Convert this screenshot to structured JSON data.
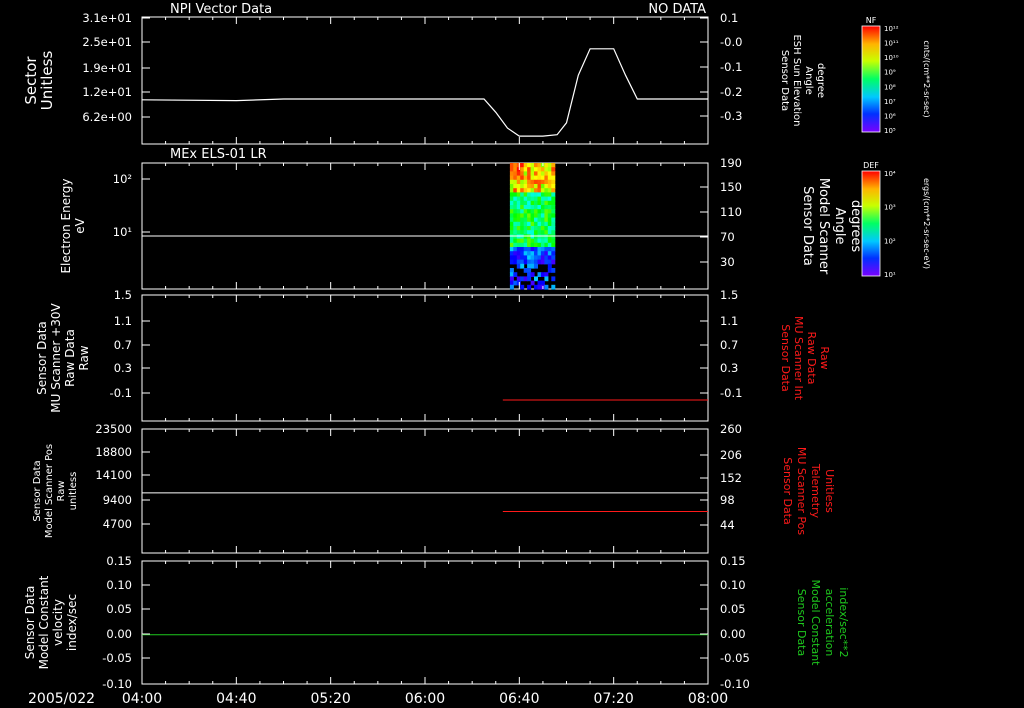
{
  "header": {
    "panel1_title": "NPI Vector Data",
    "panel1_status": "NO DATA",
    "panel2_title": "MEx ELS-01 LR"
  },
  "time_axis": {
    "date": "2005/022",
    "start": "04:00",
    "end": "08:00",
    "ticks": [
      "04:00",
      "04:40",
      "05:20",
      "06:00",
      "06:40",
      "07:20",
      "08:00"
    ]
  },
  "colors": {
    "trace": "#ffffff",
    "red": "#ff1a1a",
    "green": "#1ec81e"
  },
  "colorbars": [
    {
      "tag": "NF",
      "unit": "cnts/(cm**2-sr-sec)",
      "tick_labels": [
        "10¹²",
        "10¹¹",
        "10¹⁰",
        "10⁹",
        "10⁸",
        "10⁷",
        "10⁶",
        "10⁵"
      ]
    },
    {
      "tag": "DEF",
      "unit": "ergs/(cm**2-sr-sec-eV)",
      "tick_labels": [
        "10⁴",
        "10³",
        "10²",
        "10¹"
      ]
    }
  ],
  "chart_data": [
    {
      "type": "line",
      "left_label": [
        "Sector",
        "Unitless"
      ],
      "right_label": [
        "Sensor Data",
        "ESH Sun Elevation",
        "Angle",
        "degree"
      ],
      "left_ticks": [
        "3.1e+01",
        "2.5e+01",
        "1.9e+01",
        "1.2e+01",
        "6.2e+00"
      ],
      "right_ticks": [
        "0.1",
        "-0.0",
        "-0.1",
        "-0.2",
        "-0.3"
      ],
      "right_ylim": [
        -0.38,
        0.1
      ],
      "series": [
        {
          "color": "#ffffff",
          "axis": "right",
          "x": [
            "04:00",
            "04:40",
            "05:00",
            "05:20",
            "06:00",
            "06:25",
            "06:30",
            "06:35",
            "06:40",
            "06:50",
            "06:56",
            "07:00",
            "07:05",
            "07:10",
            "07:20",
            "07:25",
            "07:30",
            "07:35",
            "08:00"
          ],
          "y": [
            -0.213,
            -0.216,
            -0.21,
            -0.21,
            -0.21,
            -0.21,
            -0.26,
            -0.32,
            -0.35,
            -0.35,
            -0.345,
            -0.3,
            -0.12,
            -0.02,
            -0.02,
            -0.12,
            -0.21,
            -0.21,
            -0.21
          ]
        }
      ]
    },
    {
      "type": "heatmap",
      "left_label": [
        "Electron Energy",
        "eV"
      ],
      "right_label": [
        "Sensor Data",
        "Model Scanner",
        "Angle",
        "degrees"
      ],
      "left_ticks": [
        "10²",
        "10¹"
      ],
      "right_ticks": [
        "190",
        "150",
        "110",
        "70",
        "30"
      ],
      "right_ylim": [
        0,
        190
      ],
      "x_range": [
        "06:36",
        "06:55"
      ],
      "energy_range_ev": [
        0.6,
        200
      ],
      "series": [
        {
          "color": "#ffffff",
          "axis": "right",
          "x": [
            "04:00",
            "08:00"
          ],
          "y": [
            80,
            80
          ]
        }
      ]
    },
    {
      "type": "line",
      "left_label": [
        "Sensor Data",
        "MU Scanner +30V",
        "Raw Data",
        "Raw"
      ],
      "right_label": [
        "Sensor Data",
        "MU Scanner Int",
        "Raw Data",
        "Raw"
      ],
      "right_label_color": "#ff1a1a",
      "left_ticks": [
        "1.5",
        "1.1",
        "0.7",
        "0.3",
        "-0.1"
      ],
      "right_ticks": [
        "1.5",
        "1.1",
        "0.7",
        "0.3",
        "-0.1"
      ],
      "ylim": [
        -0.3,
        1.5
      ],
      "series": [
        {
          "color": "#ff1a1a",
          "axis": "right",
          "x": [
            "06:33",
            "08:00"
          ],
          "y": [
            0,
            0
          ]
        }
      ]
    },
    {
      "type": "line",
      "left_label": [
        "Sensor Data",
        "Model Scanner Pos",
        "Raw",
        "unitless"
      ],
      "right_label": [
        "Sensor Data",
        "MU Scanner Pos",
        "Telemetry",
        "Unitless"
      ],
      "right_label_color": "#ff1a1a",
      "left_ticks": [
        "23500",
        "18800",
        "14100",
        "9400",
        "4700"
      ],
      "right_ticks": [
        "260",
        "206",
        "152",
        "98",
        "44"
      ],
      "left_ylim": [
        0,
        23500
      ],
      "right_ylim": [
        0,
        260
      ],
      "series": [
        {
          "color": "#ffffff",
          "axis": "left",
          "x": [
            "04:00",
            "08:00"
          ],
          "y": [
            11400,
            11400
          ]
        },
        {
          "color": "#ff1a1a",
          "axis": "right",
          "x": [
            "06:33",
            "08:00"
          ],
          "y": [
            87,
            87
          ]
        }
      ]
    },
    {
      "type": "line",
      "left_label": [
        "Sensor Data",
        "Model Constant",
        "velocity",
        "index/sec"
      ],
      "right_label": [
        "Sensor Data",
        "Model Constant",
        "acceleration",
        "index/sec**2"
      ],
      "right_label_color": "#1ec81e",
      "left_ticks": [
        "0.15",
        "0.10",
        "0.05",
        "0.00",
        "-0.05",
        "-0.10"
      ],
      "right_ticks": [
        "0.15",
        "0.10",
        "0.05",
        "0.00",
        "-0.05",
        "-0.10"
      ],
      "ylim": [
        -0.1,
        0.15
      ],
      "series": [
        {
          "color": "#1ec81e",
          "axis": "left",
          "x": [
            "04:00",
            "08:00"
          ],
          "y": [
            0,
            0
          ]
        }
      ]
    }
  ]
}
